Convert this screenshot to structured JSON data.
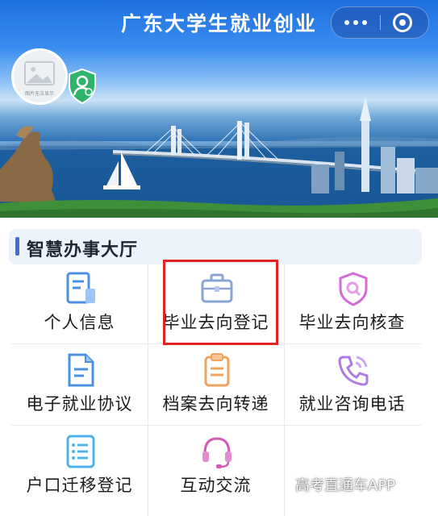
{
  "header": {
    "title": "广东大学生就业创业",
    "avatar_caption": "图片无法显示"
  },
  "section": {
    "title": "智慧办事大厅"
  },
  "services": [
    {
      "label": "个人信息",
      "icon": "id-card-icon",
      "color": "#4a90e2"
    },
    {
      "label": "毕业去向登记",
      "icon": "briefcase-icon",
      "color": "#8aa4d6"
    },
    {
      "label": "毕业去向核查",
      "icon": "shield-search-icon",
      "color": "#d36ad8"
    },
    {
      "label": "电子就业协议",
      "icon": "document-icon",
      "color": "#4a90e2"
    },
    {
      "label": "档案去向转递",
      "icon": "archive-icon",
      "color": "#f0a35c"
    },
    {
      "label": "就业咨询电话",
      "icon": "phone-icon",
      "color": "#b07be0"
    },
    {
      "label": "户口迁移登记",
      "icon": "list-icon",
      "color": "#4fb3e8"
    },
    {
      "label": "互动交流",
      "icon": "headset-icon",
      "color": "#d45ab8"
    }
  ],
  "watermark": "高考直通车APP",
  "colors": {
    "accent": "#3d6fd8",
    "highlight_border": "#e02222",
    "section_background": "#edf3fb"
  }
}
